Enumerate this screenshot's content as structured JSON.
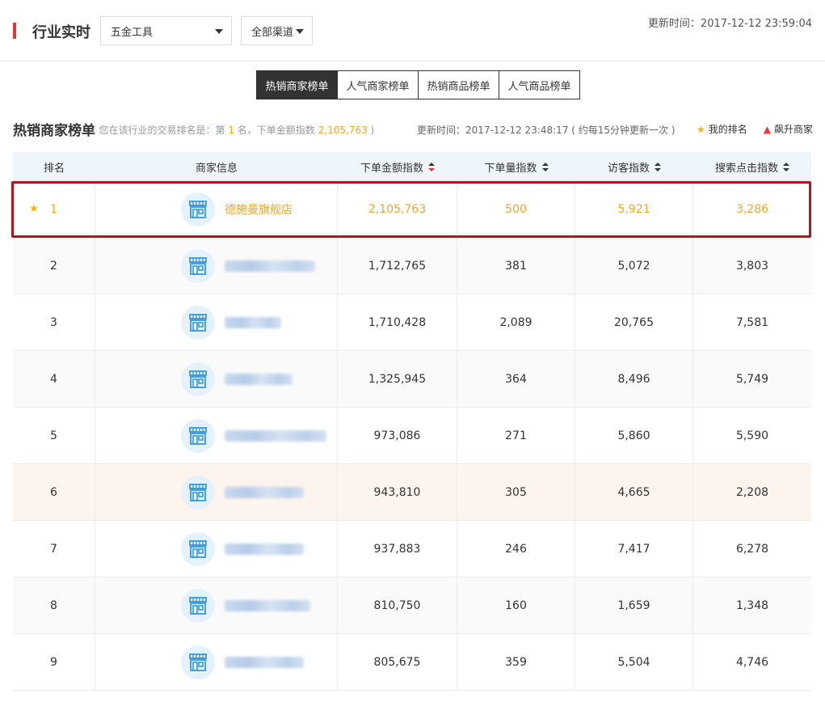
{
  "header": {
    "title": "行业实时",
    "industry_select": "五金工具",
    "channel_select": "全部渠道",
    "updated": "更新时间：2017-12-12 23:59:04"
  },
  "tabs": [
    {
      "label": "热销商家榜单",
      "active": true
    },
    {
      "label": "人气商家榜单",
      "active": false
    },
    {
      "label": "热销商品榜单",
      "active": false
    },
    {
      "label": "人气商品榜单",
      "active": false
    }
  ],
  "section": {
    "title": "热销商家榜单",
    "rank_note_prefix": "( 您在该行业的交易排名是：第",
    "rank_number": "1",
    "rank_note_middle": "名，下单金额指数",
    "rank_amount": "2,105,763",
    "rank_note_suffix": ")",
    "updated": "更新时间：2017-12-12 23:48:17 ( 约每15分钟更新一次 )",
    "legend_my_rank": "我的排名",
    "legend_rising": "飙升商家"
  },
  "table": {
    "columns": [
      "排名",
      "商家信息",
      "下单金额指数",
      "下单量指数",
      "访客指数",
      "搜索点击指数"
    ],
    "rows": [
      {
        "rank": "1",
        "name": "德施曼旗舰店",
        "amount": "2,105,763",
        "orders": "500",
        "visitors": "5,921",
        "search": "3,286"
      },
      {
        "rank": "2",
        "name": "",
        "amount": "1,712,765",
        "orders": "381",
        "visitors": "5,072",
        "search": "3,803"
      },
      {
        "rank": "3",
        "name": "",
        "amount": "1,710,428",
        "orders": "2,089",
        "visitors": "20,765",
        "search": "7,581"
      },
      {
        "rank": "4",
        "name": "",
        "amount": "1,325,945",
        "orders": "364",
        "visitors": "8,496",
        "search": "5,749"
      },
      {
        "rank": "5",
        "name": "",
        "amount": "973,086",
        "orders": "271",
        "visitors": "5,860",
        "search": "5,590"
      },
      {
        "rank": "6",
        "name": "",
        "amount": "943,810",
        "orders": "305",
        "visitors": "4,665",
        "search": "2,208"
      },
      {
        "rank": "7",
        "name": "",
        "amount": "937,883",
        "orders": "246",
        "visitors": "7,417",
        "search": "6,278"
      },
      {
        "rank": "8",
        "name": "",
        "amount": "810,750",
        "orders": "160",
        "visitors": "1,659",
        "search": "1,348"
      },
      {
        "rank": "9",
        "name": "",
        "amount": "805,675",
        "orders": "359",
        "visitors": "5,504",
        "search": "4,746"
      }
    ]
  },
  "colors": {
    "accent": "#e4393c",
    "highlight_text": "#f5a623",
    "highlight_border": "#a11d22",
    "header_bg": "#eef5fb"
  }
}
